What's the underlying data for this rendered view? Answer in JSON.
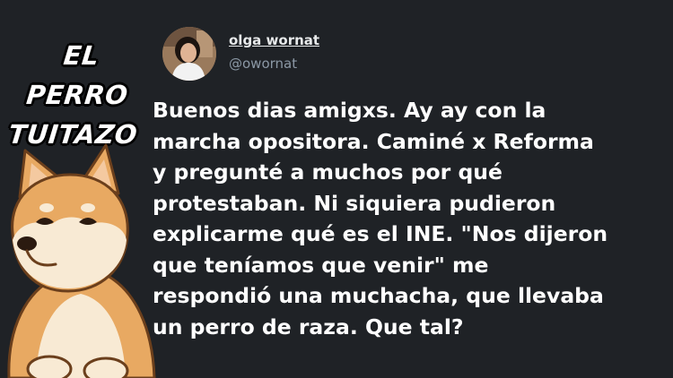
{
  "brand": {
    "line1": "EL PERRO",
    "line2": "TUITAZO"
  },
  "author": {
    "name": "olga wornat",
    "handle": "@owornat"
  },
  "tweet": {
    "text": "Buenos dias amigxs. Ay ay con la\nmarcha opositora. Caminé x Reforma\ny pregunté a muchos por qué\nprotestaban. Ni siquiera pudieron\nexplicarme qué es el INE. \"Nos dijeron\nque teníamos que venir\" me\nrespondió una muchacha, que llevaba\nun perro de raza. Que tal?"
  },
  "colors": {
    "background": "#1f2226",
    "text": "#ffffff",
    "handle": "#8b98a5",
    "doge_fur": "#e8a962",
    "doge_cream": "#f8ead4"
  },
  "icons": {
    "mascot": "doge-dog-icon",
    "avatar": "profile-photo"
  }
}
